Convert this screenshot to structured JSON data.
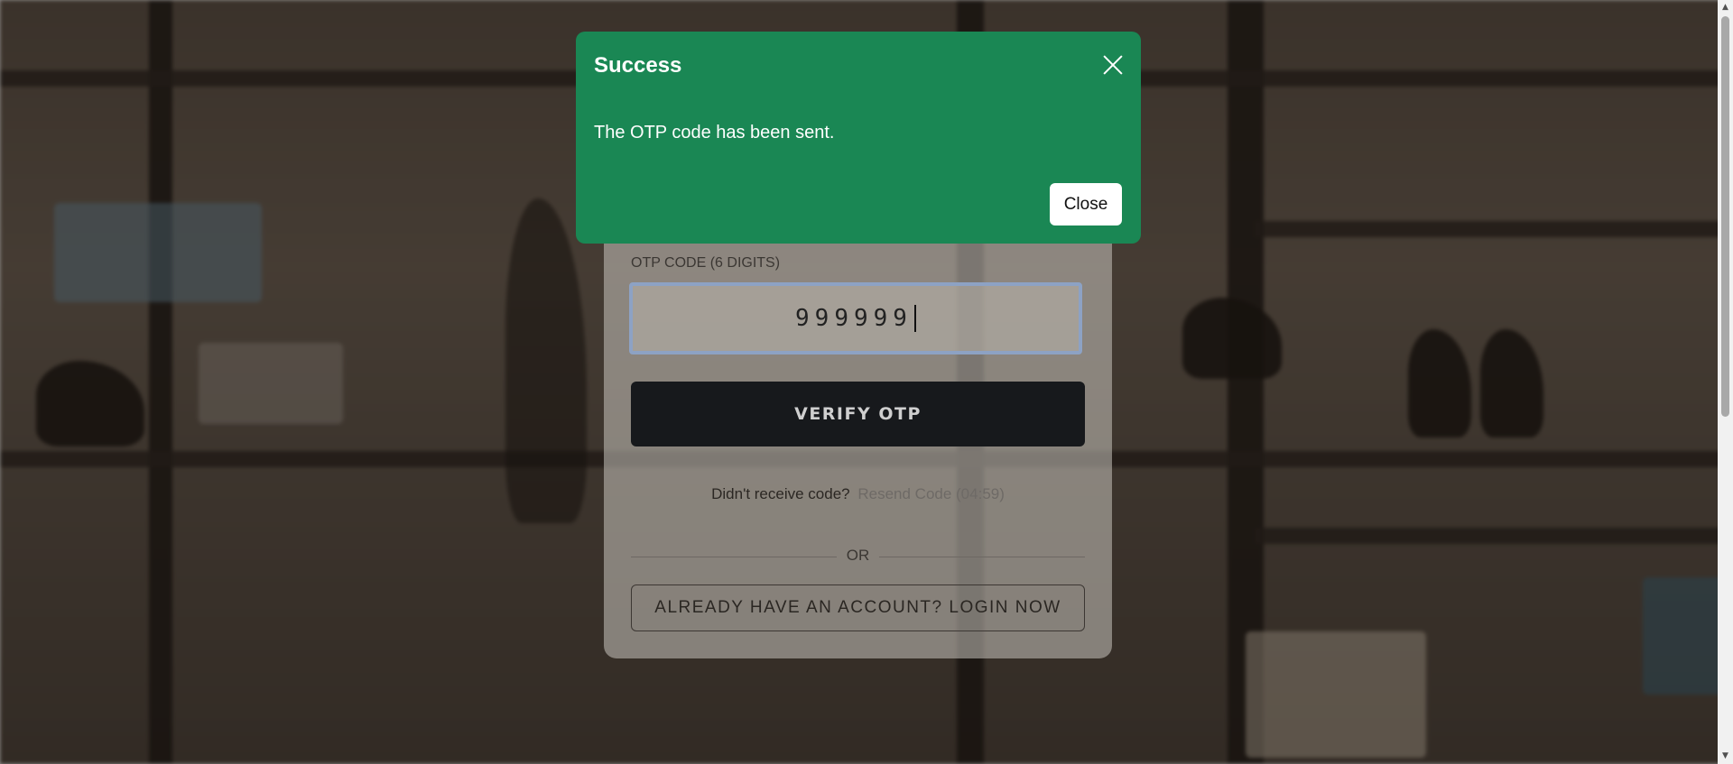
{
  "modal": {
    "title": "Success",
    "message": "The OTP code has been sent.",
    "close_label": "Close",
    "close_icon": "close-icon",
    "background_color": "#1a8754"
  },
  "form": {
    "otp_label": "OTP CODE (6 DIGITS)",
    "otp_value": "999999",
    "verify_label": "VERIFY OTP",
    "resend_prompt": "Didn't receive code?",
    "resend_link": "Resend Code (04:59)",
    "divider_text": "OR",
    "login_label": "ALREADY HAVE AN ACCOUNT? LOGIN NOW"
  }
}
